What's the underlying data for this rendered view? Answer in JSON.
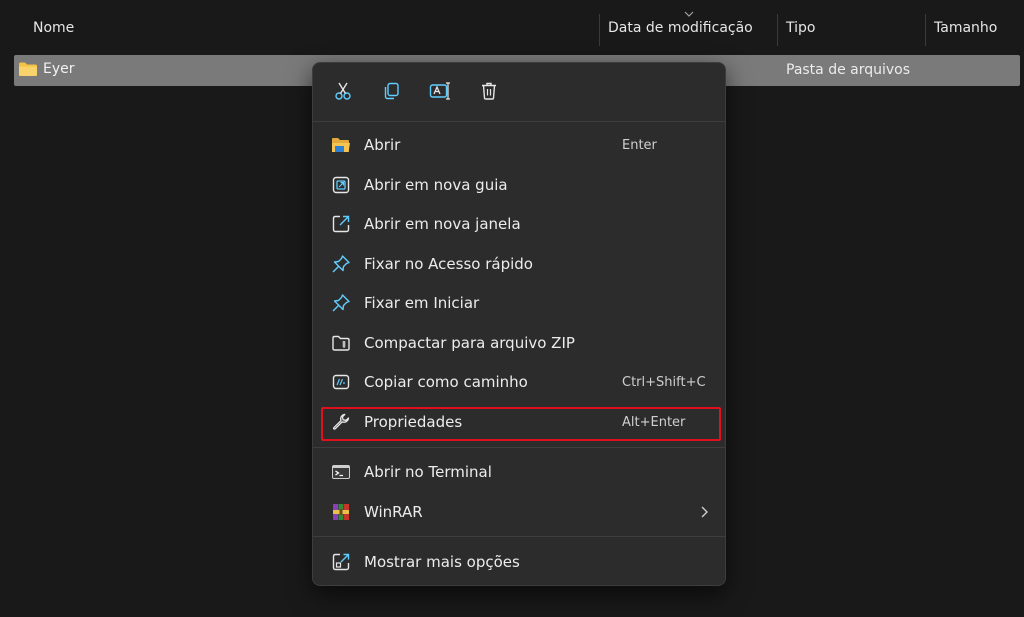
{
  "columns": {
    "name": "Nome",
    "modified": "Data de modificação",
    "type": "Tipo",
    "size": "Tamanho"
  },
  "file": {
    "name": "Eyer",
    "type": "Pasta de arquivos",
    "icon": "folder-icon"
  },
  "context_menu": {
    "quick_actions": [
      {
        "icon": "cut-icon"
      },
      {
        "icon": "copy-icon"
      },
      {
        "icon": "rename-icon"
      },
      {
        "icon": "delete-icon"
      }
    ],
    "items": [
      {
        "label": "Abrir",
        "shortcut": "Enter",
        "icon": "folder-open-icon"
      },
      {
        "label": "Abrir em nova guia",
        "shortcut": "",
        "icon": "new-tab-icon"
      },
      {
        "label": "Abrir em nova janela",
        "shortcut": "",
        "icon": "new-window-icon"
      },
      {
        "label": "Fixar no Acesso rápido",
        "shortcut": "",
        "icon": "pin-icon"
      },
      {
        "label": "Fixar em Iniciar",
        "shortcut": "",
        "icon": "pin-icon"
      },
      {
        "label": "Compactar para arquivo ZIP",
        "shortcut": "",
        "icon": "zip-icon"
      },
      {
        "label": "Copiar como caminho",
        "shortcut": "Ctrl+Shift+C",
        "icon": "copy-path-icon"
      },
      {
        "label": "Propriedades",
        "shortcut": "Alt+Enter",
        "icon": "wrench-icon"
      },
      {
        "label": "Abrir no Terminal",
        "shortcut": "",
        "icon": "terminal-icon"
      },
      {
        "label": "WinRAR",
        "shortcut": "",
        "icon": "winrar-icon"
      },
      {
        "label": "Mostrar mais opções",
        "shortcut": "",
        "icon": "more-options-icon"
      }
    ]
  },
  "colors": {
    "background": "#191919",
    "selected_row": "#7a7a7a",
    "menu_background": "#2c2c2c",
    "highlight_border": "#e0111f",
    "accent_blue": "#60cdff",
    "folder_yellow": "#f4c142"
  }
}
